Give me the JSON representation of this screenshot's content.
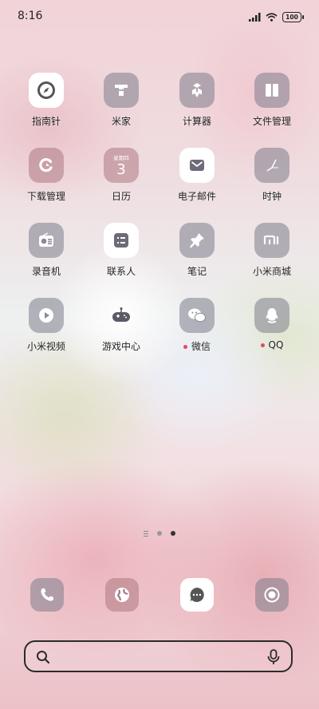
{
  "status_bar": {
    "time": "8:16",
    "battery": "100"
  },
  "apps": [
    {
      "key": "compass",
      "label": "指南针"
    },
    {
      "key": "mijia",
      "label": "米家"
    },
    {
      "key": "calculator",
      "label": "计算器"
    },
    {
      "key": "files",
      "label": "文件管理"
    },
    {
      "key": "downloads",
      "label": "下载管理"
    },
    {
      "key": "calendar",
      "label": "日历",
      "weekday": "星期四",
      "day": "3"
    },
    {
      "key": "email",
      "label": "电子邮件"
    },
    {
      "key": "clock",
      "label": "时钟"
    },
    {
      "key": "recorder",
      "label": "录音机"
    },
    {
      "key": "contacts",
      "label": "联系人"
    },
    {
      "key": "notes",
      "label": "笔记"
    },
    {
      "key": "mistore",
      "label": "小米商城",
      "logo_text": "mi"
    },
    {
      "key": "mivideo",
      "label": "小米视频"
    },
    {
      "key": "gamecenter",
      "label": "游戏中心"
    },
    {
      "key": "wechat",
      "label": "微信",
      "badge": "new"
    },
    {
      "key": "qq",
      "label": "QQ",
      "badge": "new"
    }
  ],
  "pager": {
    "pages": 2,
    "active": 2
  },
  "dock": [
    {
      "key": "phone",
      "icon": "phone-icon"
    },
    {
      "key": "browser",
      "icon": "globe-icon"
    },
    {
      "key": "messages",
      "icon": "chat-bubble-icon"
    },
    {
      "key": "camera",
      "icon": "camera-icon"
    }
  ],
  "search": {
    "value": ""
  },
  "colors": {
    "badge_red": "#e04b59",
    "icon_gray": "#7d7d8c",
    "text": "#222222"
  }
}
